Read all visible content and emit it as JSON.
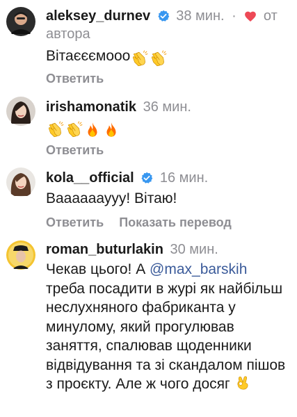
{
  "comments": [
    {
      "username": "aleksey_durnev",
      "verified": true,
      "time": "38 мин.",
      "dot": "·",
      "liked_by_author_label": "от",
      "liked_by_author_label_2": "автора",
      "text": "Вітаєєємооо",
      "emojis": [
        "clapping-hands-icon",
        "clapping-hands-icon"
      ],
      "reply_label": "Ответить"
    },
    {
      "username": "irishamonatik",
      "verified": false,
      "time": "36 мин.",
      "text": "",
      "emojis": [
        "clapping-hands-icon",
        "clapping-hands-icon",
        "fire-icon",
        "fire-icon"
      ],
      "reply_label": "Ответить"
    },
    {
      "username": "kola__official",
      "verified": true,
      "time": "16 мин.",
      "text": "Вааааааууу! Вітаю!",
      "reply_label": "Ответить",
      "translate_label": "Показать перевод"
    },
    {
      "username": "roman_buturlakin",
      "verified": false,
      "time": "30 мин.",
      "text_before_mention": "Чекав цього! А ",
      "mention": "@max_barskih",
      "text_after_mention": " треба посадити в журі як найбільш неслухняного фабриканта у минулому, який прогулював заняття, спалював щоденники відвідування та зі скандалом пішов з проєкту. Але ж чого досяг",
      "emojis": [
        "ok-hand-icon"
      ]
    }
  ],
  "colors": {
    "text": "#1a1a1a",
    "muted": "#8e8e93",
    "verified_blue": "#3897f0",
    "heart_red": "#ed4956",
    "mention": "#3b5b9a"
  }
}
